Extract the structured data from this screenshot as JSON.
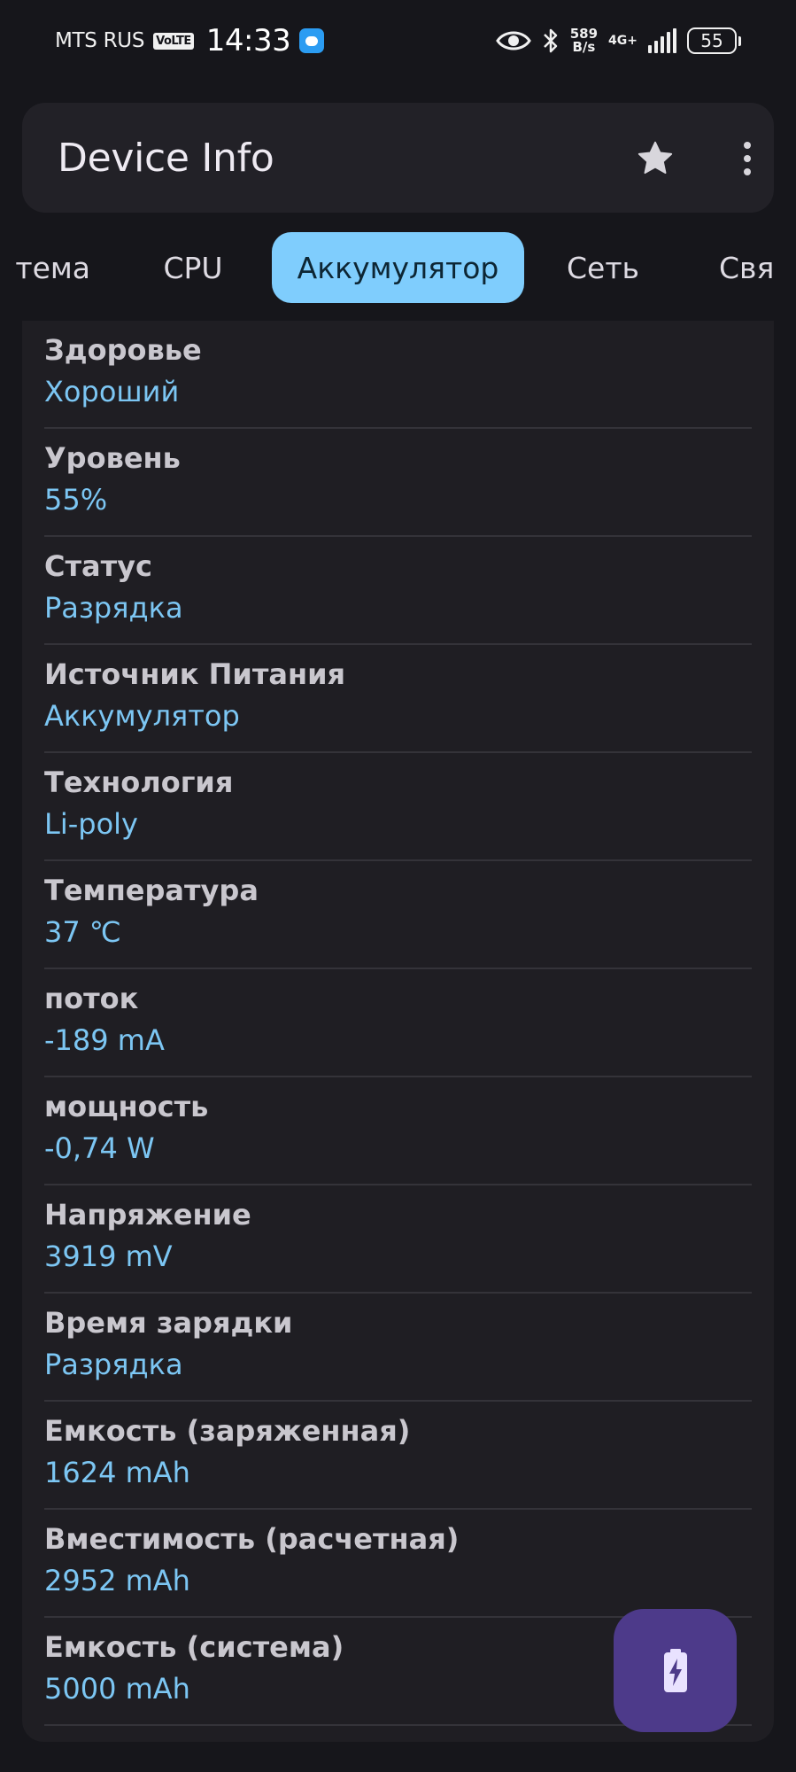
{
  "status_bar": {
    "carrier": "MTS RUS",
    "volte": "VoLTE",
    "time": "14:33",
    "net_speed_value": "589",
    "net_speed_unit": "B/s",
    "network_type": "4G+",
    "battery_level": "55"
  },
  "app_bar": {
    "title": "Device Info",
    "favorite_icon": "star-icon",
    "menu_icon": "more-vert-icon"
  },
  "tabs": [
    {
      "label": "Система",
      "visible_label": "тема"
    },
    {
      "label": "CPU"
    },
    {
      "label": "Аккумулятор",
      "active": true
    },
    {
      "label": "Сеть"
    },
    {
      "label": "Свя"
    }
  ],
  "battery_info": [
    {
      "label": "Здоровье",
      "value": "Хороший"
    },
    {
      "label": "Уровень",
      "value": "55%"
    },
    {
      "label": "Статус",
      "value": "Разрядка"
    },
    {
      "label": "Источник Питания",
      "value": "Аккумулятор"
    },
    {
      "label": "Технология",
      "value": "Li-poly"
    },
    {
      "label": "Температура",
      "value": "37 ℃"
    },
    {
      "label": "поток",
      "value": "-189 mA"
    },
    {
      "label": "мощность",
      "value": "-0,74 W"
    },
    {
      "label": "Напряжение",
      "value": "3919 mV"
    },
    {
      "label": "Время зарядки",
      "value": "Разрядка"
    },
    {
      "label": "Емкость (заряженная)",
      "value": "1624 mAh"
    },
    {
      "label": "Вместимость (расчетная)",
      "value": "2952 mAh"
    },
    {
      "label": "Емкость (система)",
      "value": "5000 mAh"
    }
  ],
  "fab": {
    "icon": "battery-charging-icon"
  },
  "colors": {
    "background": "#16161b",
    "surface": "#1f1e23",
    "accent_tab": "#7fcdfd",
    "value_text": "#7cc6f3",
    "fab": "#4d3a8a"
  }
}
